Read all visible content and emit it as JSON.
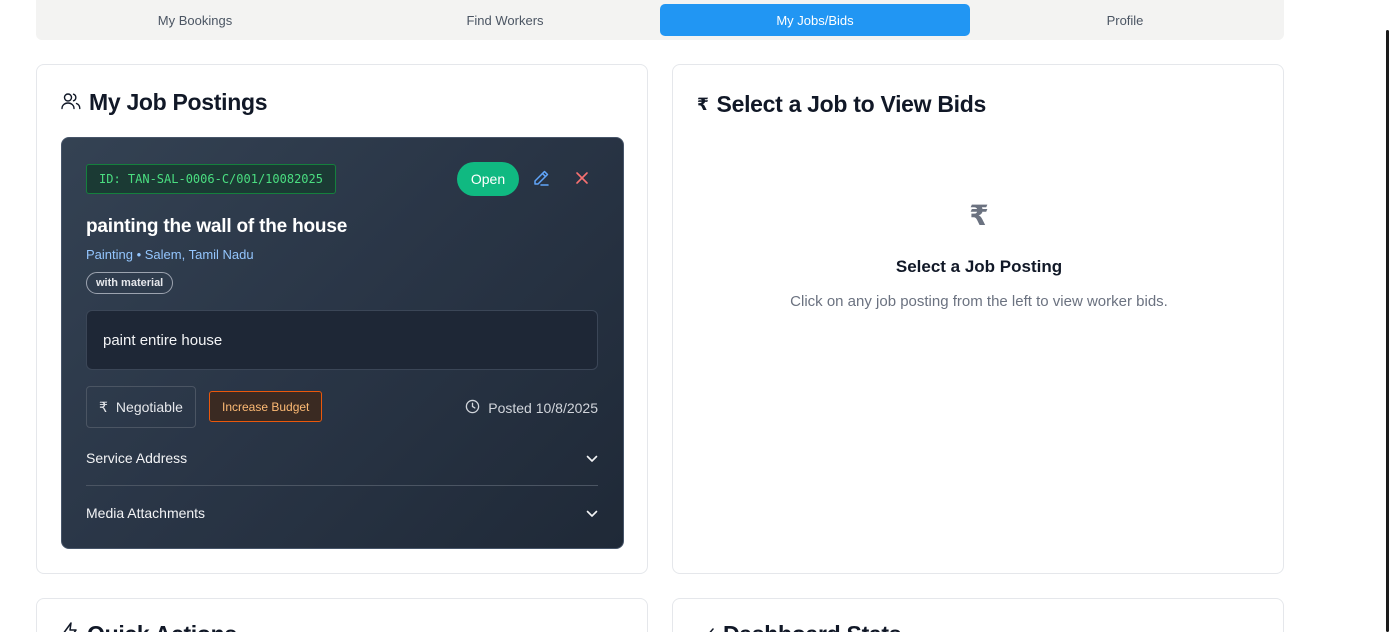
{
  "tabs": [
    {
      "label": "My Bookings",
      "active": false
    },
    {
      "label": "Find Workers",
      "active": false
    },
    {
      "label": "My Jobs/Bids",
      "active": true
    },
    {
      "label": "Profile",
      "active": false
    }
  ],
  "postings": {
    "title": "My Job Postings",
    "icon": "users-icon",
    "job": {
      "id": "ID: TAN-SAL-0006-C/001/10082025",
      "status": "Open",
      "title": "painting the wall of the house",
      "meta": "Painting • Salem, Tamil Nadu",
      "tag": "with material",
      "description": "paint entire house",
      "budget_symbol": "₹",
      "budget": "Negotiable",
      "increase_budget": "Increase Budget",
      "posted": "Posted 10/8/2025",
      "service_address": "Service Address",
      "media_attachments": "Media Attachments"
    }
  },
  "bids": {
    "icon_symbol": "₹",
    "title": "Select a Job to View Bids",
    "empty_icon": "₹",
    "empty_title": "Select a Job Posting",
    "empty_subtitle": "Click on any job posting from the left to view worker bids."
  },
  "quick_actions": {
    "title": "Quick Actions",
    "icon": "lightning-icon"
  },
  "dashboard_stats": {
    "title": "Dashboard Stats",
    "icon": "trend-icon"
  },
  "colors": {
    "accent": "#2196f3",
    "open_status": "#10b981",
    "job_id_text": "#4ade80",
    "increase_budget": "#ea580c",
    "close_icon": "#f87171"
  }
}
